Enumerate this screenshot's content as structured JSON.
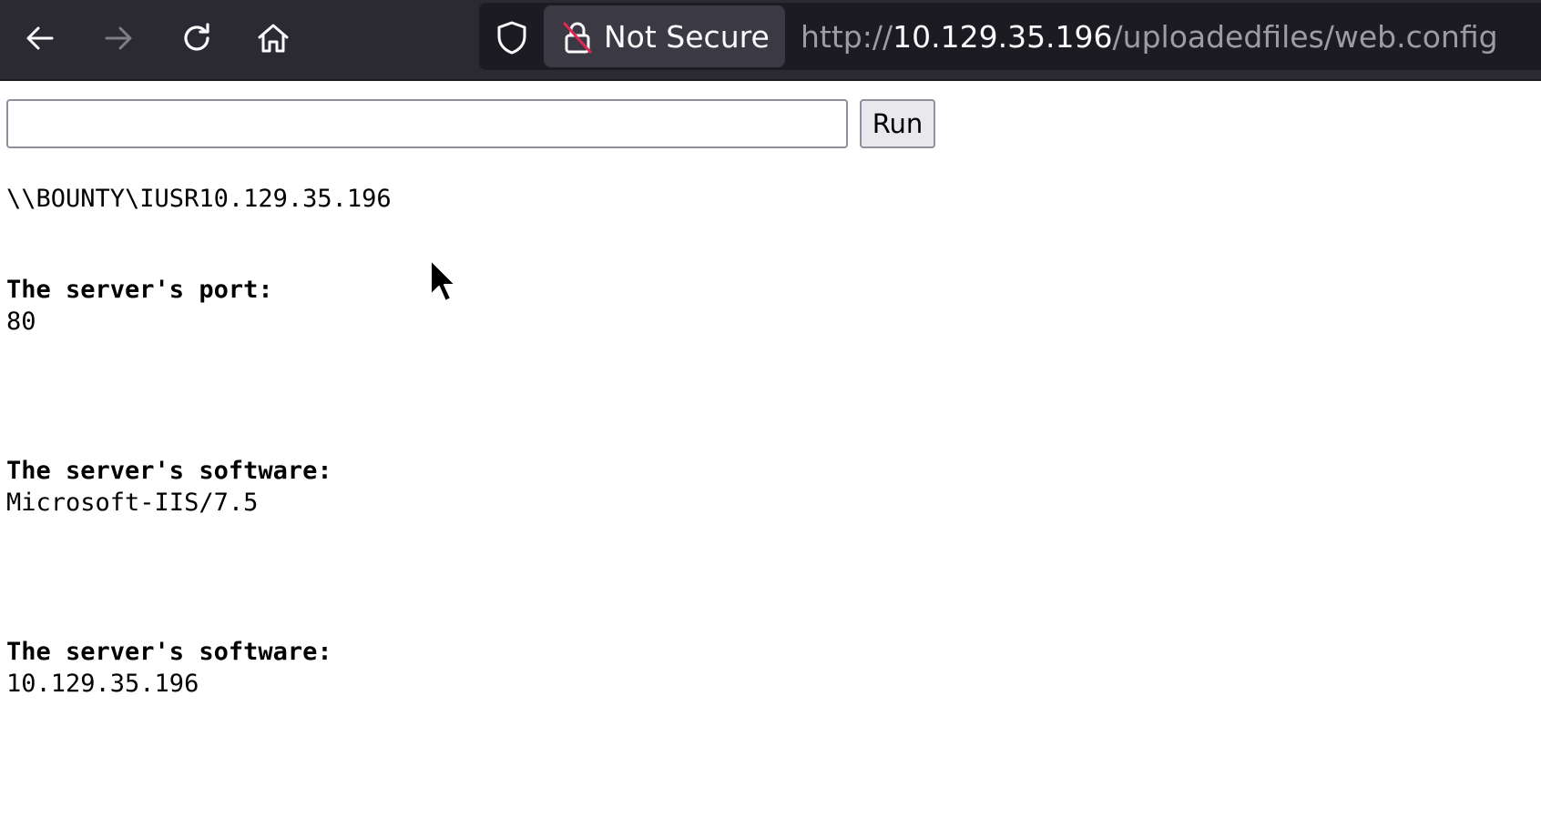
{
  "browser": {
    "security_label": "Not Secure",
    "url_scheme": "http://",
    "url_host": "10.129.35.196",
    "url_path": "/uploadedfiles/web.config",
    "icons": {
      "back": "back-arrow-icon",
      "forward": "forward-arrow-icon",
      "reload": "reload-icon",
      "home": "home-icon",
      "tracking": "shield-icon",
      "security": "insecure-lock-icon"
    }
  },
  "form": {
    "input_value": "",
    "run_label": "Run"
  },
  "output": {
    "whoami": "\\\\BOUNTY\\IUSR10.129.35.196",
    "sections": [
      {
        "label": "The server's port:",
        "value": "80"
      },
      {
        "label": "The server's software:",
        "value": "Microsoft-IIS/7.5"
      },
      {
        "label": "The server's software:",
        "value": "10.129.35.196"
      }
    ]
  },
  "colors": {
    "toolbar_bg": "#2b2a33",
    "urlbar_bg": "#1c1b22",
    "security_chip_bg": "#3a3944",
    "insecure_strike": "#e22850"
  }
}
